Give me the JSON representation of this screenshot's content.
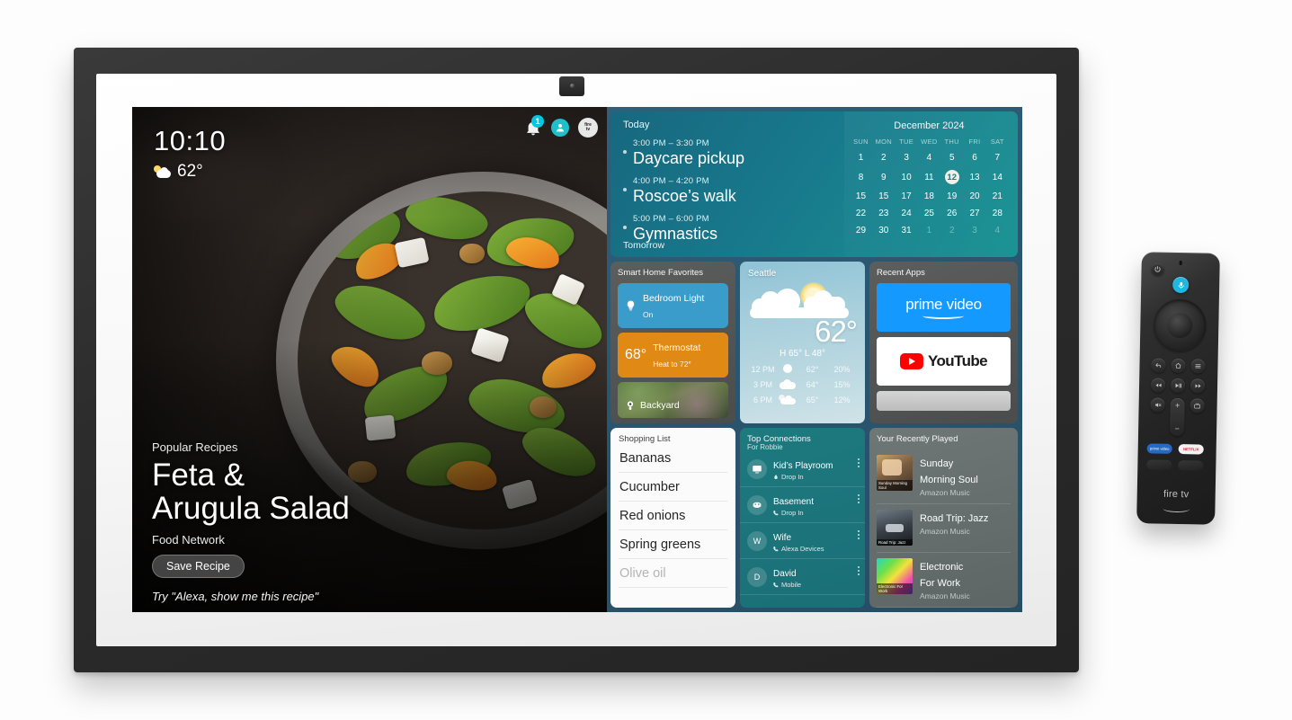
{
  "device": {
    "name": "echo-show-15-smart-display",
    "camera_icon": "camera-module"
  },
  "screen": {
    "clock": {
      "time": "10:10",
      "temp": "62°",
      "weather_icon": "sun-behind-cloud-icon"
    },
    "status_icons": {
      "notification_icon": "bell-icon",
      "notification_badge": "1",
      "profile_icon": "user-avatar-icon",
      "brand_badge": "fire-tv-logo",
      "brand_badge_line1": "fire",
      "brand_badge_line2": "tv"
    },
    "recipe": {
      "kicker": "Popular Recipes",
      "title_line1": "Feta &",
      "title_line2": "Arugula Salad",
      "source": "Food Network",
      "save_label": "Save Recipe",
      "alexa_hint": "Try \"Alexa, show me this recipe\""
    }
  },
  "calendar_widget": {
    "today_label": "Today",
    "tomorrow_label": "Tomorrow",
    "month": "December 2024",
    "events": [
      {
        "time": "3:00 PM – 3:30 PM",
        "name": "Daycare pickup"
      },
      {
        "time": "4:00 PM – 4:20 PM",
        "name": "Roscoe’s walk"
      },
      {
        "time": "5:00 PM – 6:00 PM",
        "name": "Gymnastics"
      }
    ],
    "dow": [
      "SUN",
      "MON",
      "TUE",
      "WED",
      "THU",
      "FRI",
      "SAT"
    ],
    "weeks": [
      [
        {
          "d": "1"
        },
        {
          "d": "2"
        },
        {
          "d": "3"
        },
        {
          "d": "4"
        },
        {
          "d": "5"
        },
        {
          "d": "6"
        },
        {
          "d": "7"
        }
      ],
      [
        {
          "d": "8"
        },
        {
          "d": "9"
        },
        {
          "d": "10"
        },
        {
          "d": "11"
        },
        {
          "d": "12",
          "today": true
        },
        {
          "d": "13"
        },
        {
          "d": "14"
        }
      ],
      [
        {
          "d": "15"
        },
        {
          "d": "15"
        },
        {
          "d": "17"
        },
        {
          "d": "18"
        },
        {
          "d": "19"
        },
        {
          "d": "20"
        },
        {
          "d": "21"
        }
      ],
      [
        {
          "d": "22"
        },
        {
          "d": "23"
        },
        {
          "d": "24"
        },
        {
          "d": "25"
        },
        {
          "d": "26"
        },
        {
          "d": "27"
        },
        {
          "d": "28"
        }
      ],
      [
        {
          "d": "29"
        },
        {
          "d": "30"
        },
        {
          "d": "31"
        },
        {
          "d": "1",
          "muted": true
        },
        {
          "d": "2",
          "muted": true
        },
        {
          "d": "3",
          "muted": true
        },
        {
          "d": "4",
          "muted": true
        }
      ]
    ],
    "today_date": "12"
  },
  "smart_home": {
    "title": "Smart Home Favorites",
    "tiles": [
      {
        "icon": "lightbulb-icon",
        "name": "Bedroom Light",
        "state": "On",
        "color": "#3a9ccb"
      },
      {
        "icon": "thermostat-icon",
        "temp": "68°",
        "name": "Thermostat",
        "state": "Heat to 72°",
        "color": "#e08a15"
      },
      {
        "icon": "camera-icon",
        "name": "Backyard"
      }
    ]
  },
  "weather": {
    "city": "Seattle",
    "current_temp": "62°",
    "high_low": "H 65°  L 48°",
    "condition_icon": "sun-behind-cloud-icon",
    "hourly": [
      {
        "time": "12 PM",
        "icon": "sun-icon",
        "temp": "62°",
        "precip": "20%"
      },
      {
        "time": "3 PM",
        "icon": "cloud-icon",
        "temp": "64°",
        "precip": "15%"
      },
      {
        "time": "6 PM",
        "icon": "partly-cloudy-icon",
        "temp": "65°",
        "precip": "12%"
      }
    ]
  },
  "recent_apps": {
    "title": "Recent Apps",
    "apps": [
      {
        "name": "prime video",
        "type": "prime"
      },
      {
        "name": "YouTube",
        "type": "youtube"
      },
      {
        "name": "",
        "type": "ghost"
      }
    ]
  },
  "shopping": {
    "title": "Shopping List",
    "items": [
      {
        "text": "Bananas",
        "faded": false
      },
      {
        "text": "Cucumber",
        "faded": false
      },
      {
        "text": "Red onions",
        "faded": false
      },
      {
        "text": "Spring greens",
        "faded": false
      },
      {
        "text": "Olive oil",
        "faded": true
      }
    ]
  },
  "connections": {
    "title": "Top Connections",
    "subtitle": "For Robbie",
    "rows": [
      {
        "avatar": "",
        "avatar_icon": "display-device-icon",
        "name": "Kid’s Playroom",
        "sub": "Drop In",
        "sub_icon": "drop-in-icon"
      },
      {
        "avatar": "",
        "avatar_icon": "echo-device-icon",
        "name": "Basement",
        "sub": "Drop In",
        "sub_icon": "phone-icon"
      },
      {
        "avatar": "W",
        "avatar_icon": "",
        "name": "Wife",
        "sub": "Alexa Devices",
        "sub_icon": "phone-icon"
      },
      {
        "avatar": "D",
        "avatar_icon": "",
        "name": "David",
        "sub": "Mobile",
        "sub_icon": "phone-icon"
      }
    ]
  },
  "music": {
    "title": "Your Recently Played",
    "rows": [
      {
        "name_line1": "Sunday",
        "name_line2": "Morning Soul",
        "sub": "Amazon Music",
        "thumb_label": "Sunday Morning Soul",
        "thumb_style": "warm"
      },
      {
        "name_line1": "Road Trip: Jazz",
        "name_line2": "",
        "sub": "Amazon Music",
        "thumb_label": "Road Trip: Jazz",
        "thumb_style": "dark"
      },
      {
        "name_line1": "Electronic",
        "name_line2": "For Work",
        "sub": "Amazon Music",
        "thumb_label": "Electronic For Work",
        "thumb_style": "neon"
      }
    ]
  },
  "remote": {
    "brand": "fire tv",
    "buttons": {
      "power": "power-icon",
      "voice": "microphone-icon",
      "dpad": "navigation-dpad",
      "select": "select-button",
      "back": "back-icon",
      "home": "home-icon",
      "menu": "menu-icon",
      "rewind": "rewind-icon",
      "playpause": "play-pause-icon",
      "fastforward": "fast-forward-icon",
      "mute": "mute-icon",
      "volume_up": "+",
      "volume_down": "−",
      "guide": "live-tv-icon",
      "app_prime": "prime video",
      "app_netflix": "NETFLIX"
    }
  },
  "colors": {
    "accent_teal": "#1b9494",
    "smart_blue": "#3a9ccb",
    "thermo_orange": "#e08a15",
    "prime_blue": "#1399ff",
    "youtube_red": "#ff0000",
    "netflix_red": "#d81f26"
  }
}
